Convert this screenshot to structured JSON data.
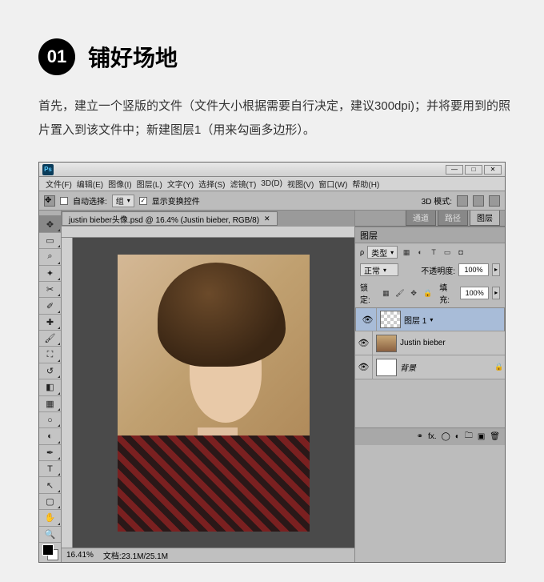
{
  "step": {
    "number": "01",
    "title": "铺好场地"
  },
  "description": "首先，建立一个竖版的文件（文件大小根据需要自行决定，建议300dpi)；并将要用到的照片置入到该文件中；新建图层1（用来勾画多边形）。",
  "ps_logo": "Ps",
  "menu": [
    "文件(F)",
    "编辑(E)",
    "图像(I)",
    "图层(L)",
    "文字(Y)",
    "选择(S)",
    "滤镜(T)",
    "3D(D)",
    "视图(V)",
    "窗口(W)",
    "帮助(H)"
  ],
  "options_bar": {
    "auto_select": "自动选择:",
    "group": "组",
    "show_controls": "显示变换控件",
    "mode3d": "3D 模式:"
  },
  "document_tab": "justin  bieber头像.psd @ 16.4% (Justin bieber, RGB/8)",
  "status": {
    "zoom": "16.41%",
    "docsize": "文档:23.1M/25.1M"
  },
  "panel_tabs_top": [
    "通道",
    "路径",
    "图层"
  ],
  "layers_panel": {
    "title": "图层",
    "kind": "类型",
    "blend": "正常",
    "opacity_label": "不透明度:",
    "opacity_val": "100%",
    "lock_label": "锁定:",
    "fill_label": "填充:",
    "fill_val": "100%",
    "layers": [
      {
        "name": "图层 1",
        "thumb": "checker",
        "selected": true
      },
      {
        "name": "Justin bieber",
        "thumb": "photo",
        "selected": false
      },
      {
        "name": "背景",
        "thumb": "white",
        "selected": false,
        "italic": true
      }
    ]
  }
}
